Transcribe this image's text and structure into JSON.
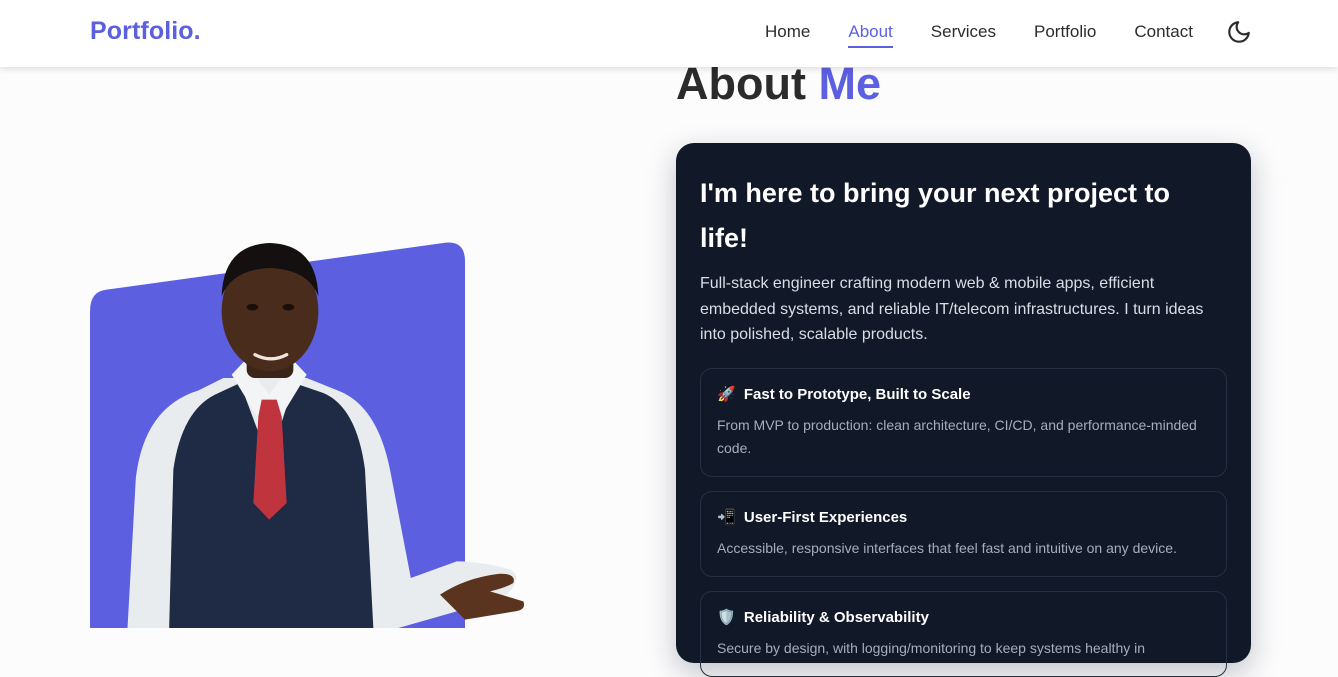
{
  "navbar": {
    "logo": "Portfolio.",
    "links": [
      "Home",
      "About",
      "Services",
      "Portfolio",
      "Contact"
    ],
    "active_link": "About",
    "theme_toggle_icon": "moon-icon"
  },
  "about": {
    "heading_main": "About",
    "heading_accent": "Me",
    "card": {
      "title": "I'm here to bring your next project to life!",
      "description": "Full-stack engineer crafting modern web & mobile apps, efficient embedded systems, and reliable IT/telecom infrastructures. I turn ideas into polished, scalable products.",
      "features": [
        {
          "emoji": "🚀",
          "title": "Fast to Prototype, Built to Scale",
          "description": "From MVP to production: clean architecture, CI/CD, and performance-minded code."
        },
        {
          "emoji": "📲",
          "title": "User-First Experiences",
          "description": "Accessible, responsive interfaces that feel fast and intuitive on any device."
        },
        {
          "emoji": "🛡️",
          "title": "Reliability & Observability",
          "description": "Secure by design, with logging/monitoring to keep systems healthy in"
        }
      ]
    }
  },
  "colors": {
    "accent": "#5b5fe0",
    "card_bg": "#111827",
    "page_bg": "#fcfcfd"
  }
}
